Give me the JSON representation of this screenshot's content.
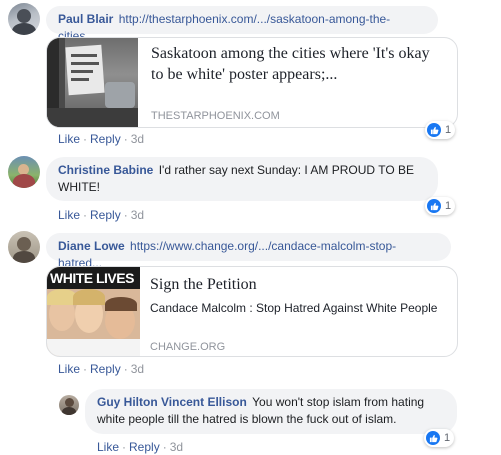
{
  "comments": [
    {
      "author": "Paul Blair",
      "text": "http://thestarphoenix.com/.../saskatoon-among-the-cities...",
      "card": {
        "title": "Saskatoon among the cities where 'It's okay to be white' poster appears;...",
        "domain": "THESTARPHOENIX.COM"
      },
      "actions": {
        "like": "Like",
        "reply": "Reply",
        "time": "3d"
      },
      "reactions": "1"
    },
    {
      "author": "Christine Babine",
      "text": "I'd rather say next Sunday: I AM PROUD TO BE WHITE!",
      "actions": {
        "like": "Like",
        "reply": "Reply",
        "time": "3d"
      },
      "reactions": "1"
    },
    {
      "author": "Diane Lowe",
      "text": "https://www.change.org/.../candace-malcolm-stop-hatred...",
      "card": {
        "image_text": "WHITE LIVES",
        "title": "Sign the Petition",
        "subtitle": "Candace Malcolm : Stop Hatred Against White People",
        "domain": "CHANGE.ORG"
      },
      "actions": {
        "like": "Like",
        "reply": "Reply",
        "time": "3d"
      }
    }
  ],
  "reply": {
    "author": "Guy Hilton Vincent Ellison",
    "text": "You won't stop islam from hating white people till the hatred is blown the fuck out of islam.",
    "actions": {
      "like": "Like",
      "reply": "Reply",
      "time": "3d"
    },
    "reactions": "1"
  },
  "colors": {
    "link": "#385898",
    "bubble": "#f2f3f5",
    "like": "#1877f2"
  }
}
